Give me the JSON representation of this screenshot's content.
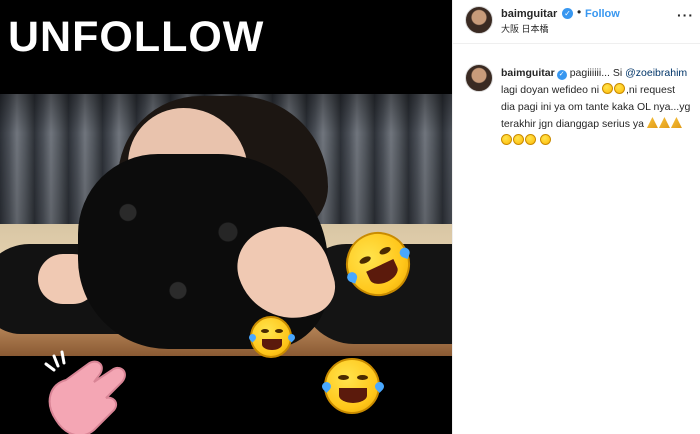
{
  "media": {
    "overlay_text": "UNFOLLOW"
  },
  "post_header": {
    "username": "baimguitar",
    "verified_mark": "✓",
    "separator": "•",
    "follow_label": "Follow",
    "location": "大阪 日本橋",
    "more_label": "···"
  },
  "caption": {
    "username": "baimguitar",
    "verified_mark": "✓",
    "text_1": "pagiiiiii... Si",
    "mention": "@zoeibrahim",
    "text_2": "lagi doyan wefideo ni",
    "text_3": ",ni request dia pagi ini ya om tante kaka OL nya...yg terakhir jgn dianggap serius ya"
  },
  "colors": {
    "link_blue": "#3897f0",
    "mention_blue": "#003569"
  }
}
